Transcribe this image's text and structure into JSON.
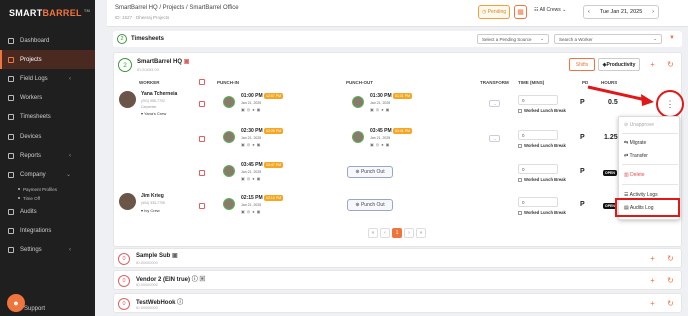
{
  "brand": {
    "logo_pre": "SMART",
    "logo_main": "BARREL",
    "logo_tm": "TM"
  },
  "sidebar": {
    "items": [
      {
        "label": "Dashboard",
        "chev": false
      },
      {
        "label": "Projects",
        "chev": false,
        "active": true
      },
      {
        "label": "Field Logs",
        "chev": true
      },
      {
        "label": "Workers",
        "chev": false
      },
      {
        "label": "Timesheets",
        "chev": false
      },
      {
        "label": "Devices",
        "chev": false
      },
      {
        "label": "Reports",
        "chev": true
      },
      {
        "label": "Company",
        "chev": true
      }
    ],
    "sub": [
      "Payment Profiles",
      "Time Off"
    ],
    "items2": [
      {
        "label": "Audits"
      },
      {
        "label": "Integrations"
      },
      {
        "label": "Settings",
        "chev": true
      }
    ],
    "support": "Support"
  },
  "topbar": {
    "breadcrumb": "SmartBarrel HQ  /  Projects  /  SmartBarrel Office",
    "subcrumb": "ID: 1527  ·  Dheeraj Projects",
    "pending": "Pending",
    "crews": "All Crews",
    "date": "Tue Jan 21, 2025"
  },
  "timesheets": {
    "count": "2",
    "title": "Timesheets",
    "pending_source": "Select a Pending Source",
    "worker": "Search a Worker"
  },
  "hq": {
    "count": "2",
    "title": "SmartBarrel HQ",
    "sub": "ID:20453 00",
    "shifts": "Shifts",
    "productivity": "Productivity",
    "headers": {
      "worker": "WORKER",
      "punchin": "PUNCH-IN",
      "punchout": "PUNCH-OUT",
      "transform": "TRANSFORM",
      "time": "TIME (MINS)",
      "pd": "PD",
      "hours": "HOURS"
    }
  },
  "rows": [
    {
      "name": "Yana Tcherneia",
      "id": "(201) 955-7702",
      "role": "Carpenter",
      "crew": "Yana's Crew",
      "in_time": "01:00 PM",
      "in_tag": "12:57 PM",
      "in_date": "Jan 21, 2025",
      "out_time": "01:30 PM",
      "out_tag": "01:31 PM",
      "out_date": "Jan 21, 2025",
      "tr": "→",
      "time": "0",
      "wlb": "Worked Lunch Break",
      "pd": "P",
      "hours": "0.5"
    },
    {
      "in_time": "02:30 PM",
      "in_tag": "02:28 PM",
      "in_date": "Jan 21, 2025",
      "out_time": "03:45 PM",
      "out_tag": "03:41 PM",
      "out_date": "Jan 21, 2025",
      "tr": "→",
      "time": "0",
      "wlb": "Worked Lunch Break",
      "pd": "P",
      "hours": "1.25"
    },
    {
      "in_time": "03:45 PM",
      "in_tag": "03:47 PM",
      "in_date": "Jan 21, 2025",
      "punch_out": "Punch Out",
      "time": "0",
      "wlb": "Worked Lunch Break",
      "pd": "P",
      "open": "OPEN"
    },
    {
      "name": "Jim Krieg",
      "id": "(404) 333-7705",
      "crew": "Ivy Crew",
      "in_time": "02:15 PM",
      "in_tag": "02:13 PM",
      "in_date": "Jan 21, 2025",
      "punch_out": "Punch Out",
      "time": "0",
      "wlb": "Worked Lunch Break",
      "pd": "P",
      "open": "OPEN"
    }
  ],
  "pagination": [
    "«",
    "‹",
    "1",
    "›",
    "»"
  ],
  "projects": [
    {
      "count": "0",
      "title": "Sample Sub",
      "sub": "ID:00000000"
    },
    {
      "count": "0",
      "title": "Vendor 2 (EIN true)",
      "sub": "ID:00000000"
    },
    {
      "count": "0",
      "title": "TestWebHook",
      "sub": "ID:00000000"
    }
  ],
  "menu": {
    "items": [
      {
        "label": "Unapprove",
        "cls": "dis"
      },
      {
        "label": "Migrate",
        "cls": ""
      },
      {
        "label": "Transfer",
        "cls": ""
      },
      {
        "label": "Delete",
        "cls": "del"
      },
      {
        "label": "Activity Logs",
        "cls": ""
      },
      {
        "label": "Audits Log",
        "cls": ""
      }
    ]
  },
  "colors": {
    "accent": "#f0743e",
    "highlight": "#e01818",
    "sidebar": "#1f1f1f"
  }
}
